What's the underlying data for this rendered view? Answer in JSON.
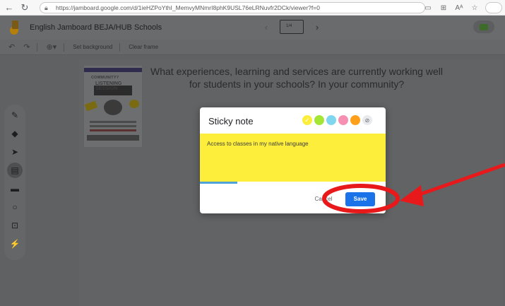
{
  "browser": {
    "url": "https://jamboard.google.com/d/1ieHZPoYthI_MemvyMNmrI8phK9USL76eLRNuvfr2DCk/viewer?f=0",
    "icons": [
      "back-icon",
      "reload-icon",
      "lock-icon",
      "reader-icon",
      "grid-icon",
      "read-aloud-icon",
      "favorite-icon"
    ]
  },
  "app": {
    "title": "English Jamboard BEJA/HUB Schools",
    "frame_label": "1/4"
  },
  "toolbar": {
    "set_background": "Set background",
    "clear_frame": "Clear frame"
  },
  "canvas": {
    "question": "What experiences, learning and services are currently working well for students in your schools? In your community?",
    "poster": {
      "caption": "COMMUNITY?",
      "heading": "LISTENING SESSION"
    }
  },
  "dialog": {
    "title": "Sticky note",
    "colors": [
      "#fcee3b",
      "#a3e635",
      "#7fd6ef",
      "#f78fb3",
      "#ff9f1a"
    ],
    "selected_color": "#fcee3b",
    "note_text": "Access to classes in my native language",
    "char_progress": 0.2,
    "cancel_label": "Cancel",
    "save_label": "Save"
  }
}
